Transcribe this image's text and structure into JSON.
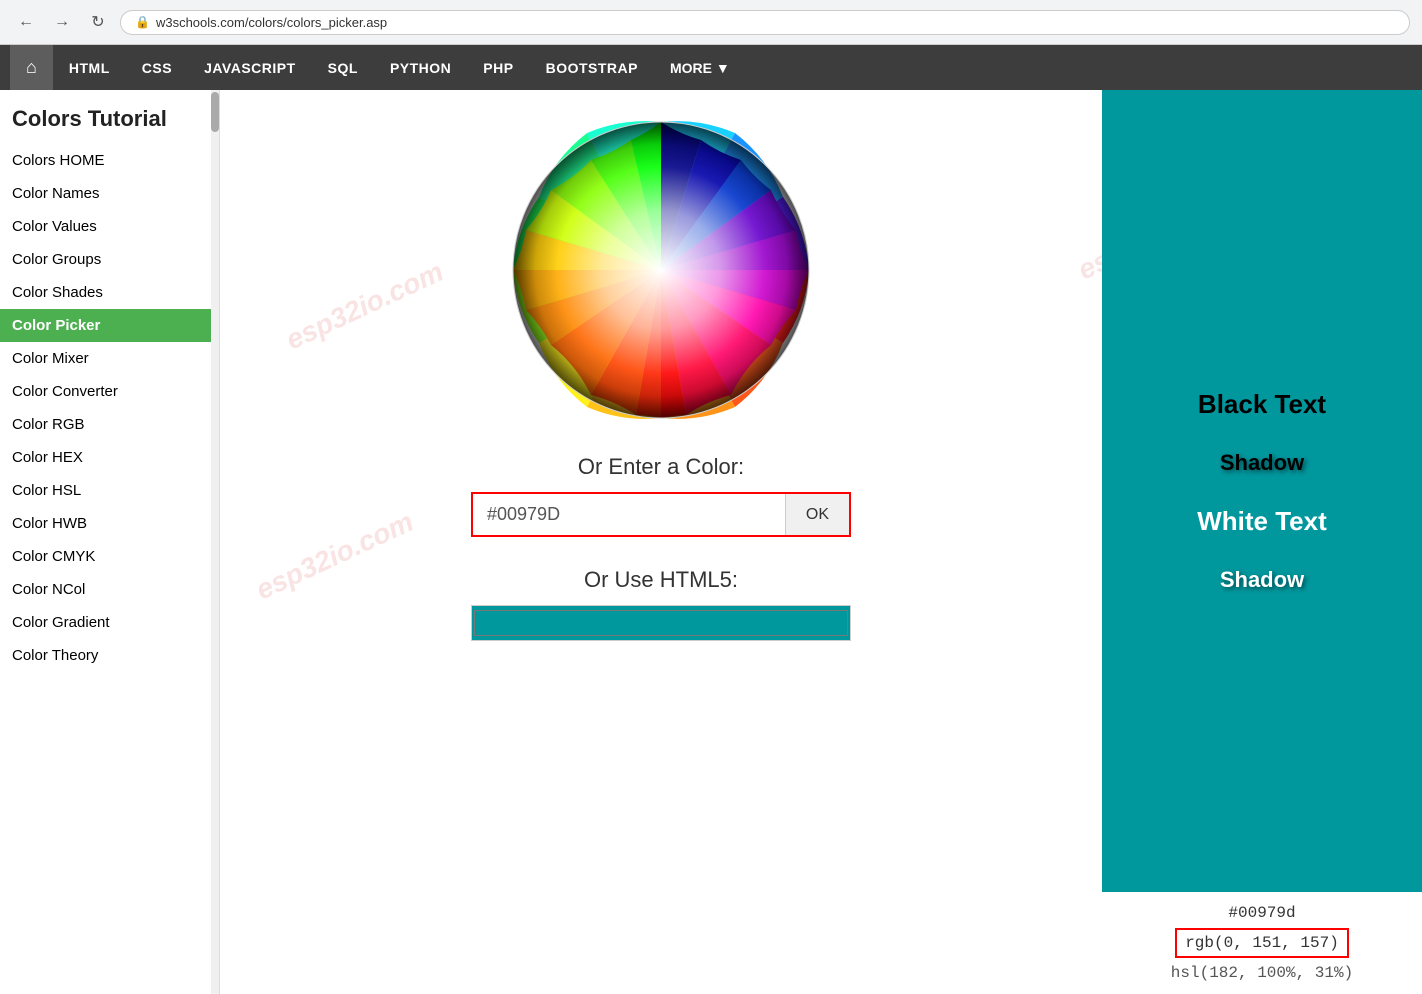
{
  "browser": {
    "url": "w3schools.com/colors/colors_picker.asp",
    "back_label": "←",
    "forward_label": "→",
    "reload_label": "↻"
  },
  "topnav": {
    "home_icon": "⌂",
    "items": [
      {
        "label": "HTML",
        "href": "#"
      },
      {
        "label": "CSS",
        "href": "#"
      },
      {
        "label": "JAVASCRIPT",
        "href": "#"
      },
      {
        "label": "SQL",
        "href": "#"
      },
      {
        "label": "PYTHON",
        "href": "#"
      },
      {
        "label": "PHP",
        "href": "#"
      },
      {
        "label": "BOOTSTRAP",
        "href": "#"
      },
      {
        "label": "MORE ▼",
        "href": "#"
      }
    ]
  },
  "sidebar": {
    "title": "Colors Tutorial",
    "items": [
      {
        "label": "Colors HOME",
        "active": false
      },
      {
        "label": "Color Names",
        "active": false
      },
      {
        "label": "Color Values",
        "active": false
      },
      {
        "label": "Color Groups",
        "active": false
      },
      {
        "label": "Color Shades",
        "active": false
      },
      {
        "label": "Color Picker",
        "active": true
      },
      {
        "label": "Color Mixer",
        "active": false
      },
      {
        "label": "Color Converter",
        "active": false
      },
      {
        "label": "Color RGB",
        "active": false
      },
      {
        "label": "Color HEX",
        "active": false
      },
      {
        "label": "Color HSL",
        "active": false
      },
      {
        "label": "Color HWB",
        "active": false
      },
      {
        "label": "Color CMYK",
        "active": false
      },
      {
        "label": "Color NCol",
        "active": false
      },
      {
        "label": "Color Gradient",
        "active": false
      },
      {
        "label": "Color Theory",
        "active": false
      }
    ]
  },
  "main": {
    "enter_color_label": "Or Enter a Color:",
    "color_input_value": "#00979D",
    "ok_button_label": "OK",
    "html5_label": "Or Use HTML5:"
  },
  "right_panel": {
    "black_text_label": "Black Text",
    "shadow_label_1": "Shadow",
    "white_text_label": "White Text",
    "shadow_label_2": "Shadow",
    "color_hex": "#00979d",
    "color_rgb": "rgb(0, 151, 157)",
    "color_hsl": "hsl(182, 100%, 31%)",
    "bg_color": "#00979D"
  },
  "watermarks": [
    "esp32io.com",
    "esp32io.com",
    "esp32io.com",
    "esp32io.com"
  ]
}
